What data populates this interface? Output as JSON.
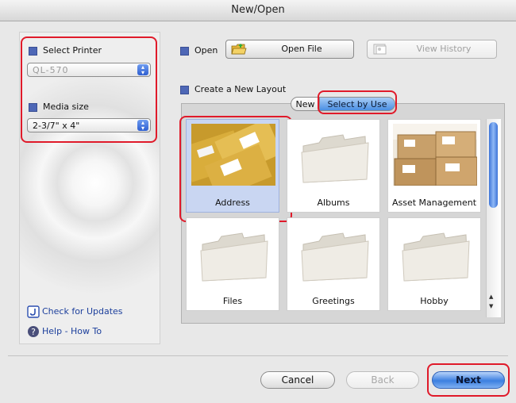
{
  "window": {
    "title": "New/Open"
  },
  "left_panel": {
    "select_printer_label": "Select Printer",
    "printer_value": "QL-570",
    "media_size_label": "Media size",
    "media_size_value": "2-3/7\" x 4\"",
    "check_updates_label": "Check for Updates",
    "help_label": "Help - How To"
  },
  "open_section": {
    "label": "Open",
    "open_file_button": "Open File",
    "view_history_button": "View History"
  },
  "create_section": {
    "label": "Create a New Layout",
    "tabs": [
      {
        "label": "New",
        "selected": false
      },
      {
        "label": "Select by Use",
        "selected": true
      }
    ]
  },
  "templates": [
    {
      "label": "Address",
      "selected": true,
      "thumbnail": "envelopes-photo"
    },
    {
      "label": "Albums",
      "selected": false,
      "thumbnail": "folder-icon"
    },
    {
      "label": "Asset Management",
      "selected": false,
      "thumbnail": "boxes-photo"
    },
    {
      "label": "Files",
      "selected": false,
      "thumbnail": "folder-icon"
    },
    {
      "label": "Greetings",
      "selected": false,
      "thumbnail": "folder-icon"
    },
    {
      "label": "Hobby",
      "selected": false,
      "thumbnail": "folder-icon"
    }
  ],
  "footer": {
    "cancel_button": "Cancel",
    "back_button": "Back",
    "next_button": "Next"
  },
  "colors": {
    "highlight_box": "#e01a2a",
    "section_square": "#4e67b6",
    "selected_tile": "#c9d6f2",
    "default_button": "#3c7fe0"
  }
}
